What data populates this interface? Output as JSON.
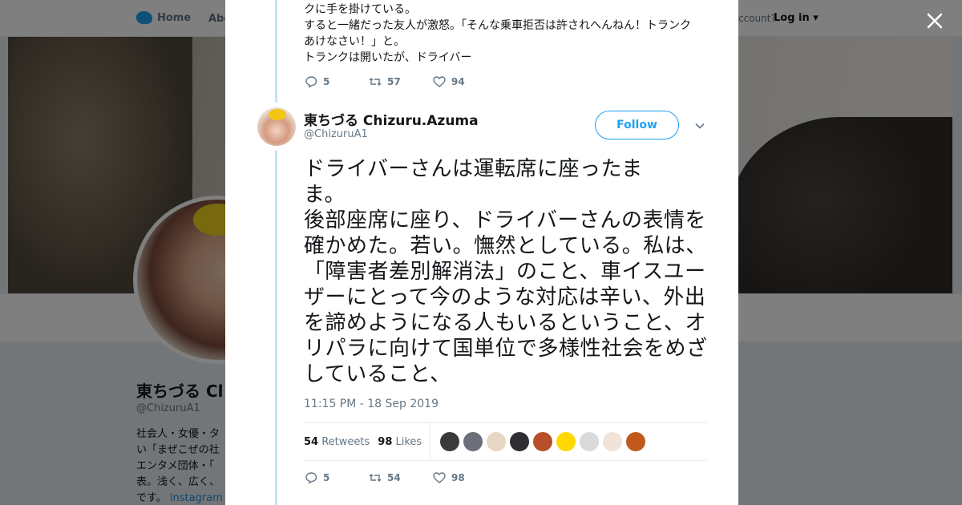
{
  "nav": {
    "home_label": "Home",
    "about_label": "Abo",
    "account_text": "ccount?",
    "login_label": "Log in"
  },
  "profile": {
    "name": "東ちづる Cl",
    "handle": "@ChizuruA1",
    "bio_lines": [
      "社会人・女優・タ",
      "い「まぜこぜの社",
      "エンタメ団体・「",
      "表。浅く、広く、",
      "です。"
    ],
    "bio_link": "instagram"
  },
  "modal": {
    "close_icon": "close-icon",
    "previous_tweet": {
      "lines": [
        "クに手を掛けている。",
        "すると一緒だった友人が激怒。「そんな乗車拒否は許されへんねん！トランク",
        "あけなさい！」と。",
        "トランクは開いたが、ドライバー"
      ],
      "replies": "5",
      "retweets": "57",
      "likes": "94"
    },
    "tweet": {
      "author_name": "東ちづる Chizuru.Azuma",
      "author_handle": "@ChizuruA1",
      "follow_label": "Follow",
      "text": "ドライバーさんは運転席に座ったまま。\n後部座席に座り、ドライバーさんの表情を確かめた。若い。憮然としている。私は、「障害者差別解消法」のこと、車イスユーザーにとって今のような対応は辛い、外出を諦めようになる人もいるということ、オリパラに向けて国単位で多様性社会をめざしていること、",
      "timestamp": "11:15 PM - 18 Sep 2019",
      "retweet_count": "54",
      "retweet_label": "Retweets",
      "like_count": "98",
      "like_label": "Likes",
      "liker_colors": [
        "#3a3a3a",
        "#6b6f7a",
        "#e8d6c4",
        "#2f2f33",
        "#b7502a",
        "#ffd800",
        "#d8dadc",
        "#f1e3d8",
        "#c05a1c"
      ],
      "replies": "5",
      "retweets": "54",
      "likes": "98"
    }
  },
  "colors": {
    "accent": "#1da1f2",
    "thread_line": "#c4e4f7",
    "muted_text": "#657786"
  }
}
